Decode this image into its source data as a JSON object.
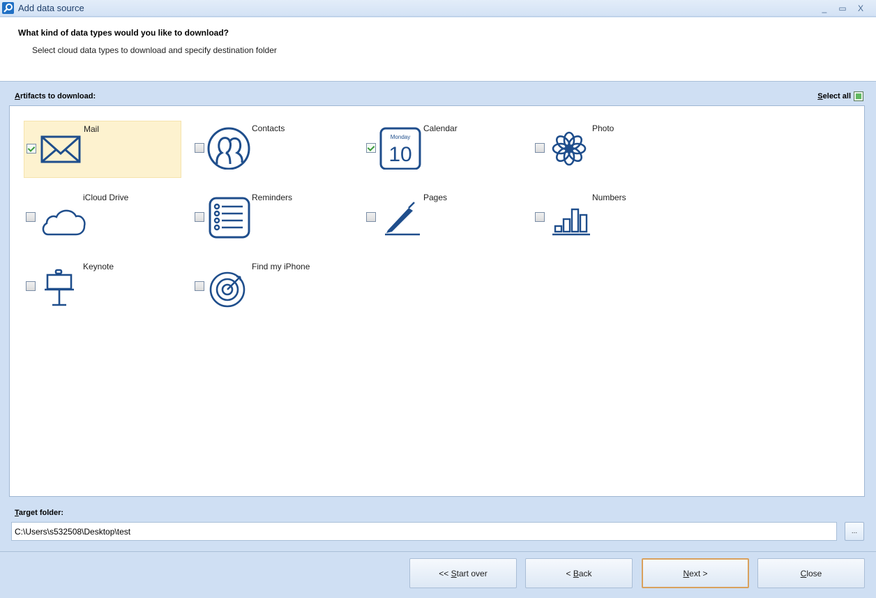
{
  "window": {
    "title": "Add data source",
    "minimize_glyph": "_",
    "maximize_glyph": "▭",
    "close_glyph": "X"
  },
  "header": {
    "question": "What kind of data types would you like to download?",
    "subtitle": "Select cloud data types to download and specify destination folder"
  },
  "artifacts": {
    "label_accel": "A",
    "label_rest": "rtifacts to download:",
    "select_all_accel": "S",
    "select_all_rest": "elect all",
    "items": [
      {
        "label": "Mail",
        "checked": true,
        "highlighted": true,
        "icon": "envelope-icon"
      },
      {
        "label": "Contacts",
        "checked": false,
        "icon": "contacts-icon"
      },
      {
        "label": "Calendar",
        "checked": true,
        "icon": "calendar-icon",
        "calendar_day": "Monday",
        "calendar_date": "10"
      },
      {
        "label": "Photo",
        "checked": false,
        "icon": "flower-icon"
      },
      {
        "label": "iCloud Drive",
        "checked": false,
        "icon": "cloud-icon"
      },
      {
        "label": "Reminders",
        "checked": false,
        "icon": "list-icon"
      },
      {
        "label": "Pages",
        "checked": false,
        "icon": "pen-icon"
      },
      {
        "label": "Numbers",
        "checked": false,
        "icon": "bar-chart-icon"
      },
      {
        "label": "Keynote",
        "checked": false,
        "icon": "presentation-icon"
      },
      {
        "label": "Find my iPhone",
        "checked": false,
        "icon": "radar-icon"
      }
    ]
  },
  "target": {
    "label_accel": "T",
    "label_rest": "arget folder:",
    "path": "C:\\Users\\s532508\\Desktop\\test",
    "browse_label": "..."
  },
  "footer": {
    "start_over_prefix": "<< ",
    "start_over_accel": "S",
    "start_over_rest": "tart over",
    "back_prefix": "< ",
    "back_accel": "B",
    "back_rest": "ack",
    "next_accel": "N",
    "next_rest": "ext >",
    "close_accel": "C",
    "close_rest": "lose"
  },
  "colors": {
    "accent": "#1f4e8c",
    "selected_bg": "#fdf2cf",
    "default_button_border": "#d9a15d"
  }
}
